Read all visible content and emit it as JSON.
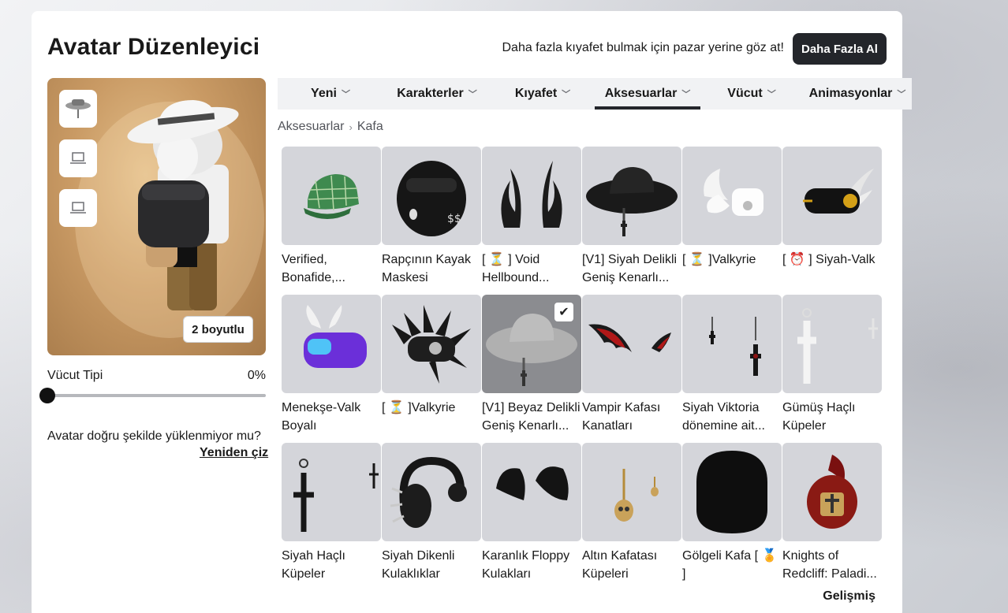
{
  "header": {
    "title": "Avatar Düzenleyici",
    "promo_text": "Daha fazla kıyafet bulmak için pazar yerine göz at!",
    "get_more_button": "Daha Fazla Al"
  },
  "preview": {
    "dimension_toggle": "2 boyutlu"
  },
  "body_type": {
    "label": "Vücut Tipi",
    "value": "0%",
    "level": 0
  },
  "reload": {
    "message": "Avatar doğru şekilde yüklenmiyor mu?",
    "link": "Yeniden çiz"
  },
  "tabs": [
    {
      "label": "Yeni"
    },
    {
      "label": "Karakterler"
    },
    {
      "label": "Kıyafet"
    },
    {
      "label": "Aksesuarlar",
      "active": true
    },
    {
      "label": "Vücut"
    },
    {
      "label": "Animasyonlar"
    }
  ],
  "breadcrumb": [
    "Aksesuarlar",
    "Kafa"
  ],
  "items": [
    {
      "name": "Verified, Bonafide,...",
      "icon": "green-plaid-cap"
    },
    {
      "name": "Rapçının Kayak Maskesi",
      "icon": "black-ski-mask"
    },
    {
      "name": "[ ⏳ ] Void Hellbound...",
      "icon": "black-horns"
    },
    {
      "name": "[V1] Siyah Delikli Geniş Kenarlı...",
      "icon": "black-wide-hat"
    },
    {
      "name": "[ ⏳ ]Valkyrie",
      "icon": "white-valkyrie"
    },
    {
      "name": "[ ⏰ ] Siyah-Valk",
      "icon": "black-valk"
    },
    {
      "name": "Menekşe-Valk Boyalı",
      "icon": "purple-valk"
    },
    {
      "name": "[ ⏳ ]Valkyrie",
      "icon": "black-spiky-valkyrie"
    },
    {
      "name": "[V1] Beyaz Delikli Geniş Kenarlı...",
      "icon": "white-wide-hat",
      "selected": true
    },
    {
      "name": "Vampir Kafası Kanatları",
      "icon": "vampire-wings"
    },
    {
      "name": "Siyah Viktoria dönemine ait...",
      "icon": "black-victorian-earrings"
    },
    {
      "name": "Gümüş Haçlı Küpeler",
      "icon": "silver-cross-earrings"
    },
    {
      "name": "Siyah Haçlı Küpeler",
      "icon": "black-cross-earrings"
    },
    {
      "name": "Siyah Dikenli Kulaklıklar",
      "icon": "black-spiked-headphones"
    },
    {
      "name": "Karanlık Floppy Kulakları",
      "icon": "dark-floppy-ears"
    },
    {
      "name": "Altın Kafatası Küpeleri",
      "icon": "gold-skull-earrings"
    },
    {
      "name": "Gölgeli Kafa [ 🏅 ]",
      "icon": "shadow-head"
    },
    {
      "name": "Knights of Redcliff: Paladi...",
      "icon": "redcliff-helmet"
    }
  ],
  "footer": {
    "advanced": "Gelişmiş"
  }
}
